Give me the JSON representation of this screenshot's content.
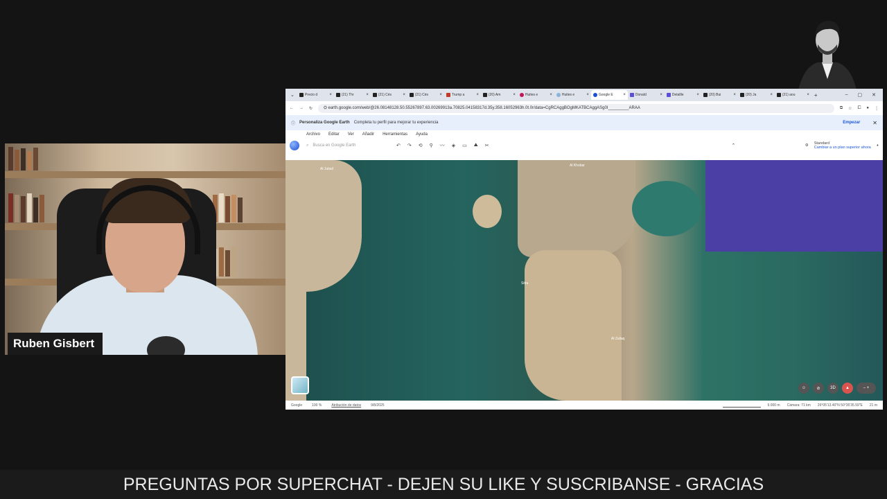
{
  "webcam": {
    "name": "Ruben Gisbert"
  },
  "browser": {
    "tabs": [
      {
        "label": "Precio d",
        "icon": "rt-icon"
      },
      {
        "label": "(21) Thr",
        "icon": "x-icon"
      },
      {
        "label": "(21) Cés",
        "icon": "x-icon"
      },
      {
        "label": "(21) Cés",
        "icon": "x-icon"
      },
      {
        "label": "Trump a",
        "icon": "flag-icon"
      },
      {
        "label": "(20) Am",
        "icon": "x-icon"
      },
      {
        "label": "Huites e",
        "icon": "info-icon"
      },
      {
        "label": "Huites e",
        "icon": "globe-icon"
      },
      {
        "label": "Google E",
        "icon": "earth-icon",
        "active": true
      },
      {
        "label": "Donald",
        "icon": "t-icon"
      },
      {
        "label": "Detallle",
        "icon": "t-icon"
      },
      {
        "label": "(20) Bui",
        "icon": "x-icon"
      },
      {
        "label": "(20) Ja",
        "icon": "x-icon"
      },
      {
        "label": "(21) aou",
        "icon": "x-icon"
      }
    ],
    "url": "earth.google.com/web/@26.08148128.50.55267897.63.00269913a.70825.04158317d.35y.358.16052963h.0t.0r/data=CgRCAggBOgMKATBCAggASg0I_________ARAA",
    "promo": {
      "title": "Personaliza Google Earth",
      "text": "Completa tu perfil para mejorar tu experiencia",
      "action": "Empezar"
    },
    "menu": [
      "Archivo",
      "Editar",
      "Ver",
      "Añadir",
      "Herramientas",
      "Ayuda"
    ],
    "search_placeholder": "Busca en Google Earth",
    "plan": {
      "title": "Standard",
      "subtitle": "Cambiar a un plan superior ahora"
    },
    "map_labels": [
      "Al Jubail",
      "Al Khobar",
      "Sitra",
      "Al Zallaq"
    ],
    "tools": [
      "3D"
    ],
    "status": {
      "brand": "Google",
      "zoom": "100 %",
      "attribution": "Atribución de datos",
      "date": "9/8/2025",
      "scale": "9.000 m",
      "camera": "Cámara: 71 km",
      "coords": "26°05'13.40\"N 50°35'35.59\"E",
      "altitude": "21 m"
    }
  },
  "ticker": "PREGUNTAS POR SUPERCHAT - DEJEN SU LIKE Y SUSCRIBANSE - GRACIAS",
  "colors": {
    "accent": "#1a56d6",
    "background": "#141414"
  }
}
